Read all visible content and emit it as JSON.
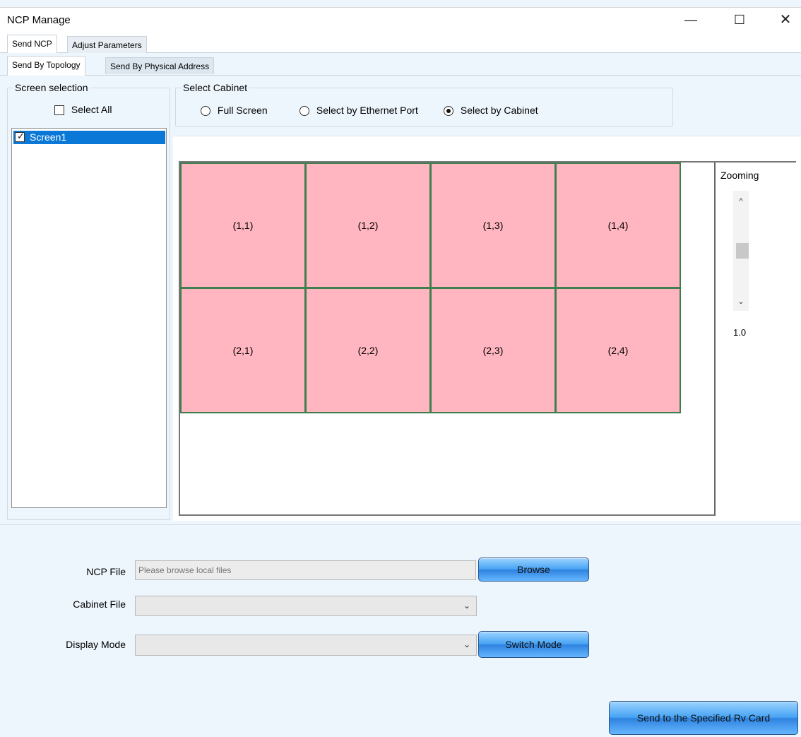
{
  "window": {
    "title": "NCP Manage",
    "controls": {
      "minimize": "—",
      "maximize": "☐",
      "close": "✕"
    }
  },
  "tabs_main": [
    {
      "label": "Send NCP",
      "active": true
    },
    {
      "label": "Adjust Parameters",
      "active": false
    }
  ],
  "tabs_sub": [
    {
      "label": "Send By Topology",
      "active": true
    },
    {
      "label": "Send By Physical Address",
      "active": false
    }
  ],
  "screen_selection": {
    "title": "Screen selection",
    "select_all_label": "Select All",
    "select_all_checked": false,
    "screens": [
      {
        "label": "Screen1",
        "checked": true,
        "selected": true
      }
    ]
  },
  "select_cabinet": {
    "title": "Select Cabinet",
    "options": [
      {
        "label": "Full Screen",
        "selected": false
      },
      {
        "label": "Select by Ethernet Port",
        "selected": false
      },
      {
        "label": "Select by Cabinet",
        "selected": true
      }
    ]
  },
  "topology": {
    "cabinets": [
      [
        "(1,1)",
        "(1,2)",
        "(1,3)",
        "(1,4)"
      ],
      [
        "(2,1)",
        "(2,2)",
        "(2,3)",
        "(2,4)"
      ]
    ],
    "cabinet_color": "#ffb6c1",
    "border_color": "#3e7e4f"
  },
  "zooming": {
    "label": "Zooming",
    "value": "1.0",
    "up_icon": "chevron-up-icon",
    "down_icon": "chevron-down-icon"
  },
  "form": {
    "ncp_file_label": "NCP File",
    "ncp_file_placeholder": "Please browse local files",
    "browse_label": "Browse",
    "cabinet_file_label": "Cabinet File",
    "cabinet_file_value": "",
    "display_mode_label": "Display Mode",
    "display_mode_value": "",
    "switch_mode_label": "Switch Mode",
    "send_label": "Send to the Specified Rv Card"
  },
  "colors": {
    "accent": "#0a78d7",
    "button_blue": "#47a3f4",
    "panel_bg": "#eef6fd"
  }
}
